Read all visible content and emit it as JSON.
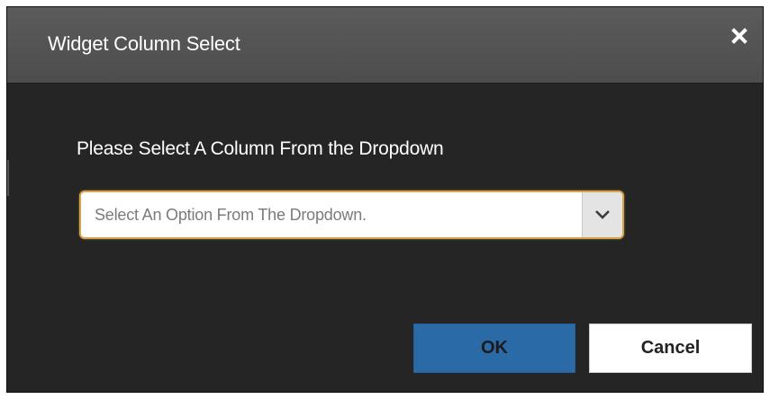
{
  "dialog": {
    "title": "Widget Column Select",
    "close_icon": "close-icon",
    "prompt": "Please Select A Column From the Dropdown",
    "dropdown": {
      "value": "Select An Option From The Dropdown.",
      "arrow_icon": "chevron-down-icon"
    },
    "buttons": {
      "ok_label": "OK",
      "cancel_label": "Cancel"
    }
  },
  "colors": {
    "dialog_bg": "#252525",
    "titlebar_bg": "#555555",
    "ok_bg": "#2a6aa6",
    "focus_border": "#d8a44a"
  }
}
